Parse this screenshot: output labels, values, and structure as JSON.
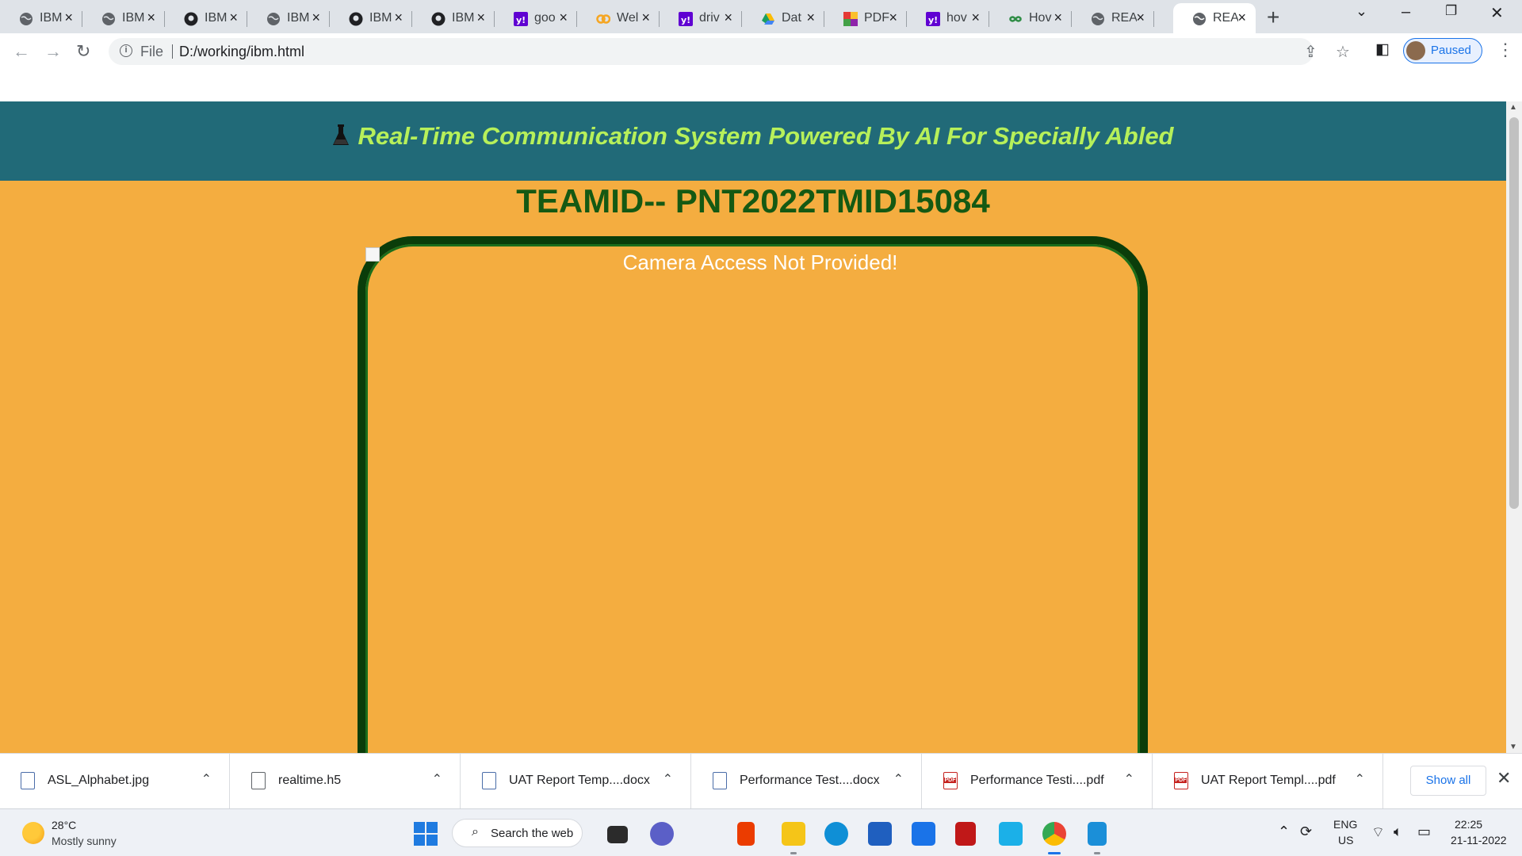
{
  "browser": {
    "tabs": [
      {
        "title": "IBM",
        "icon": "globe-icon"
      },
      {
        "title": "IBM",
        "icon": "globe-icon"
      },
      {
        "title": "IBM",
        "icon": "github-icon"
      },
      {
        "title": "IBM",
        "icon": "globe-icon"
      },
      {
        "title": "IBM",
        "icon": "github-icon"
      },
      {
        "title": "IBM",
        "icon": "github-icon"
      },
      {
        "title": "goo",
        "icon": "yahoo-icon"
      },
      {
        "title": "Wel",
        "icon": "coursera-icon"
      },
      {
        "title": "driv",
        "icon": "yahoo-icon"
      },
      {
        "title": "Dat",
        "icon": "google-drive-icon"
      },
      {
        "title": "PDF",
        "icon": "pdf-tool-icon"
      },
      {
        "title": "hov",
        "icon": "yahoo-icon"
      },
      {
        "title": "Hov",
        "icon": "geeksforgeeks-icon"
      },
      {
        "title": "REA",
        "icon": "globe-icon"
      },
      {
        "title": "REA",
        "icon": "globe-icon",
        "active": true
      }
    ],
    "address": {
      "scheme_label": "File",
      "url": "D:/working/ibm.html"
    },
    "profile_label": "Paused"
  },
  "page": {
    "title": "Real-Time Communication System Powered By AI For Specially Abled",
    "team_id": "TEAMID-- PNT2022TMID15084",
    "camera_message": "Camera Access Not Provided!",
    "colors": {
      "header_bg": "#216a78",
      "title_color": "#b7f05a",
      "body_bg": "#f4ad40",
      "team_color": "#155913",
      "frame_border": "#0a3d0a"
    }
  },
  "downloads": {
    "items": [
      {
        "name": "ASL_Alphabet.jpg",
        "icon": "image-file-icon"
      },
      {
        "name": "realtime.h5",
        "icon": "file-icon"
      },
      {
        "name": "UAT Report Temp....docx",
        "icon": "word-doc-icon"
      },
      {
        "name": "Performance Test....docx",
        "icon": "word-doc-icon"
      },
      {
        "name": "Performance Testi....pdf",
        "icon": "pdf-icon"
      },
      {
        "name": "UAT Report Templ....pdf",
        "icon": "pdf-icon"
      }
    ],
    "show_all_label": "Show all"
  },
  "taskbar": {
    "weather_temp": "28°C",
    "weather_desc": "Mostly sunny",
    "search_label": "Search the web",
    "lang_line1": "ENG",
    "lang_line2": "US",
    "time": "22:25",
    "date": "21-11-2022"
  }
}
